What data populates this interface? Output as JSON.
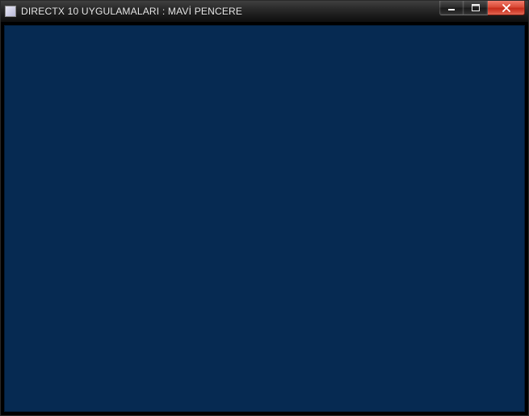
{
  "window": {
    "title": "DIRECTX 10 UYGULAMALARI : MAVİ PENCERE"
  },
  "client": {
    "background_color": "#062a52"
  }
}
